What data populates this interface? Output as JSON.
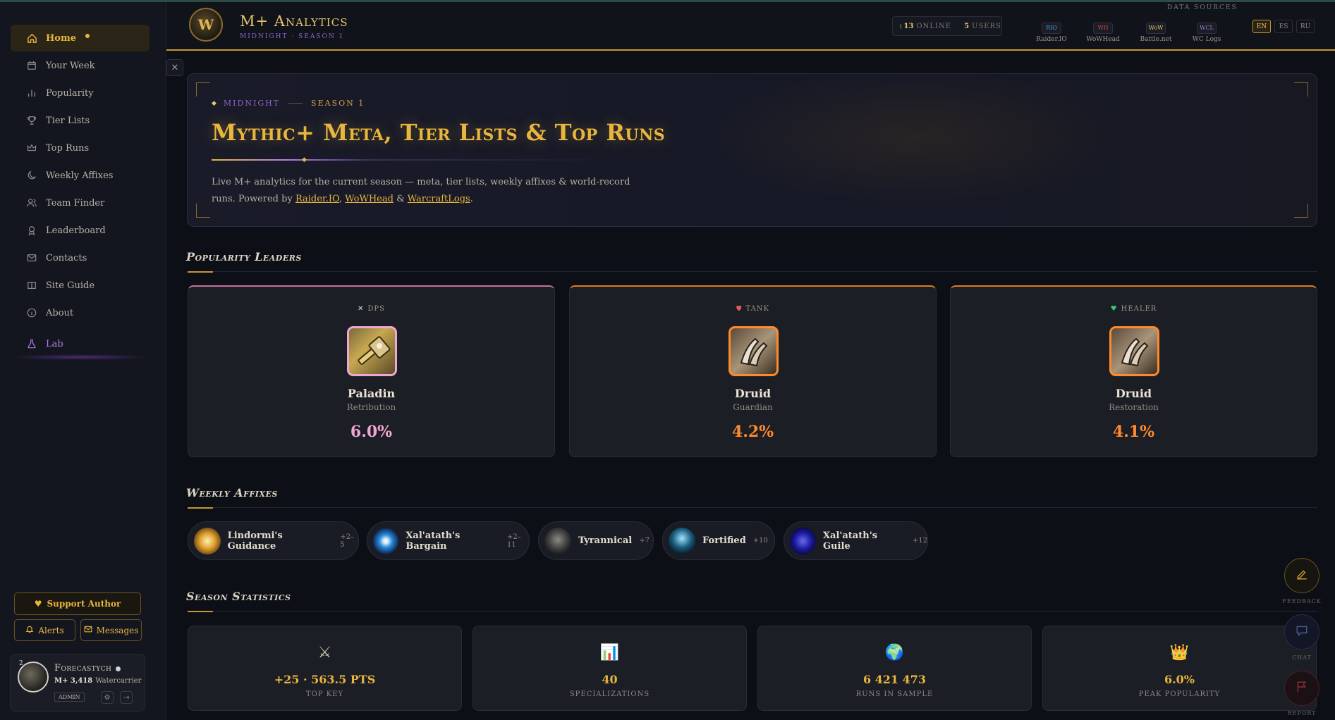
{
  "sidebar": {
    "items": [
      {
        "label": "Home",
        "icon": "home-icon"
      },
      {
        "label": "Your Week",
        "icon": "calendar-icon"
      },
      {
        "label": "Popularity",
        "icon": "bar-chart-icon"
      },
      {
        "label": "Tier Lists",
        "icon": "trophy-icon"
      },
      {
        "label": "Top Runs",
        "icon": "crown-icon"
      },
      {
        "label": "Weekly Affixes",
        "icon": "moon-icon"
      },
      {
        "label": "Team Finder",
        "icon": "users-icon"
      },
      {
        "label": "Leaderboard",
        "icon": "medal-icon"
      },
      {
        "label": "Contacts",
        "icon": "mail-icon"
      },
      {
        "label": "Site Guide",
        "icon": "book-icon"
      },
      {
        "label": "About",
        "icon": "info-icon"
      },
      {
        "label": "Lab",
        "icon": "flask-icon"
      }
    ],
    "support_label": "Support Author",
    "alerts_label": "Alerts",
    "messages_label": "Messages",
    "profile": {
      "badge_number": "2",
      "name": "Forecastych",
      "rating": "M+ 3,418",
      "title": "Watercarrier",
      "role": "ADMIN"
    }
  },
  "header": {
    "logo_letter": "W",
    "brand": "M+ Analytics",
    "subtitle": "MIDNIGHT · SEASON 1",
    "online_count": "13",
    "online_label": "ONLINE",
    "users_count": "5",
    "users_label": "USERS",
    "data_sources_title": "DATA SOURCES",
    "data_sources": [
      {
        "badge": "RIO",
        "name": "Raider.IO",
        "color": "#4aa3e0"
      },
      {
        "badge": "WH",
        "name": "WoWHead",
        "color": "#d0483a"
      },
      {
        "badge": "WoW",
        "name": "Battle.net",
        "color": "#e7c46a"
      },
      {
        "badge": "WCL",
        "name": "WC Logs",
        "color": "#9a7fd0"
      }
    ],
    "languages": [
      "EN",
      "ES",
      "RU"
    ],
    "active_language": "EN"
  },
  "hero": {
    "eyebrow_a": "MIDNIGHT",
    "eyebrow_b": "SEASON 1",
    "title": "Mythic+ Meta, Tier Lists & Top Runs",
    "desc_prefix": "Live M+ analytics for the current season — meta, tier lists, weekly affixes & world-record runs. Powered by ",
    "link_1": "Raider.IO",
    "sep_1": ", ",
    "link_2": "WoWHead",
    "sep_2": " & ",
    "link_3": "WarcraftLogs",
    "desc_suffix": "."
  },
  "popularity": {
    "title": "Popularity Leaders",
    "cards": [
      {
        "role": "DPS",
        "role_icon": "crossed-swords-icon",
        "class": "Paladin",
        "spec": "Retribution",
        "percent": "6.0%",
        "accent": "#f0a6d3",
        "top": "#c9709e"
      },
      {
        "role": "TANK",
        "role_icon": "shield-icon",
        "class": "Druid",
        "spec": "Guardian",
        "percent": "4.2%",
        "accent": "#ff8a2b",
        "top": "#e07a1f"
      },
      {
        "role": "HEALER",
        "role_icon": "heart-icon",
        "class": "Druid",
        "spec": "Restoration",
        "percent": "4.1%",
        "accent": "#ff8a2b",
        "top": "#e07a1f"
      }
    ]
  },
  "affixes": {
    "title": "Weekly Affixes",
    "items": [
      {
        "name": "Lindormi's Guidance",
        "levels": "+2–5"
      },
      {
        "name": "Xal'atath's Bargain",
        "levels": "+2–11"
      },
      {
        "name": "Tyrannical",
        "levels": "+7"
      },
      {
        "name": "Fortified",
        "levels": "+10"
      },
      {
        "name": "Xal'atath's Guile",
        "levels": "+12"
      }
    ]
  },
  "stats": {
    "title": "Season Statistics",
    "items": [
      {
        "icon": "⚔",
        "value": "+25 · 563.5 PTS",
        "label": "TOP KEY"
      },
      {
        "icon": "📊",
        "value": "40",
        "label": "SPECIALIZATIONS"
      },
      {
        "icon": "🌍",
        "value": "6 421 473",
        "label": "RUNS IN SAMPLE"
      },
      {
        "icon": "👑",
        "value": "6.0%",
        "label": "PEAK POPULARITY"
      }
    ]
  },
  "float_buttons": {
    "feedback": "FEEDBACK",
    "chat": "CHAT",
    "report": "REPORT"
  }
}
